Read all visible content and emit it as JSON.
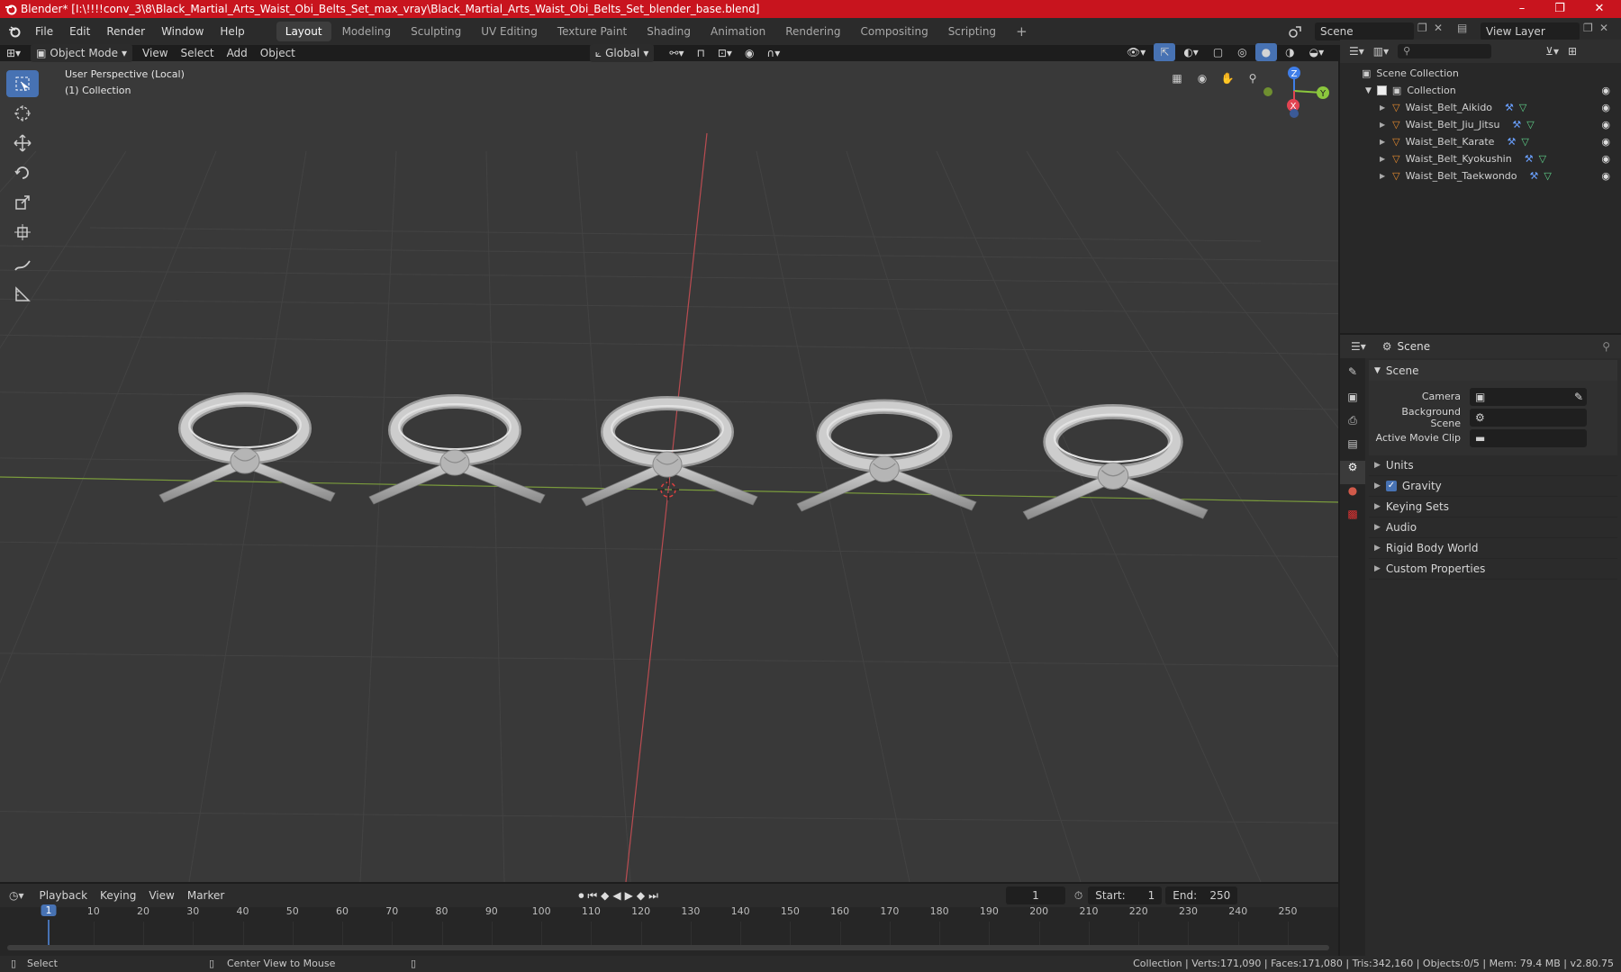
{
  "window": {
    "title": "Blender* [I:\\!!!!conv_3\\8\\Black_Martial_Arts_Waist_Obi_Belts_Set_max_vray\\Black_Martial_Arts_Waist_Obi_Belts_Set_blender_base.blend]",
    "controls": [
      "–",
      "❐",
      "✕"
    ]
  },
  "menubar": {
    "menus": [
      "File",
      "Edit",
      "Render",
      "Window",
      "Help"
    ],
    "workspaces": [
      "Layout",
      "Modeling",
      "Sculpting",
      "UV Editing",
      "Texture Paint",
      "Shading",
      "Animation",
      "Rendering",
      "Compositing",
      "Scripting"
    ],
    "active_workspace": "Layout",
    "add_tab": "+",
    "scene_name": "Scene",
    "view_layer": "View Layer"
  },
  "viewport_header": {
    "mode": "Object Mode",
    "menus": [
      "View",
      "Select",
      "Add",
      "Object"
    ],
    "transform_orientation": "Global"
  },
  "viewport": {
    "perspective_label": "User Perspective (Local)",
    "collection_label": "(1) Collection",
    "gizmo_axes": {
      "z": "Z",
      "y": "Y",
      "x": "X"
    }
  },
  "outliner": {
    "root": "Scene Collection",
    "collection": "Collection",
    "objects": [
      "Waist_Belt_Aikido",
      "Waist_Belt_Jiu_Jitsu",
      "Waist_Belt_Karate",
      "Waist_Belt_Kyokushin",
      "Waist_Belt_Taekwondo"
    ]
  },
  "properties": {
    "header": "Scene",
    "panel": "Scene",
    "fields": [
      {
        "label": "Camera"
      },
      {
        "label": "Background Scene"
      },
      {
        "label": "Active Movie Clip"
      }
    ],
    "sections": [
      "Units",
      "Gravity",
      "Keying Sets",
      "Audio",
      "Rigid Body World",
      "Custom Properties"
    ],
    "gravity_checked": true
  },
  "timeline": {
    "menus": [
      "Playback",
      "Keying",
      "View",
      "Marker"
    ],
    "current_frame": "1",
    "start_label": "Start:",
    "start": "1",
    "end_label": "End:",
    "end": "250",
    "ticks": [
      "1",
      "10",
      "20",
      "30",
      "40",
      "50",
      "60",
      "70",
      "80",
      "90",
      "100",
      "110",
      "120",
      "130",
      "140",
      "150",
      "160",
      "170",
      "180",
      "190",
      "200",
      "210",
      "220",
      "230",
      "240",
      "250"
    ]
  },
  "statusbar": {
    "left": "Select",
    "middle": "Center View to Mouse",
    "right": "Collection | Verts:171,090 | Faces:171,080 | Tris:342,160 | Objects:0/5 | Mem: 79.4 MB | v2.80.75"
  },
  "colors": {
    "title_red": "#c8141e",
    "accent_blue": "#4772b3",
    "object_orange": "#e48a2e",
    "axis_x": "#e24452",
    "axis_y": "#8bc73d",
    "axis_z": "#3f7ee8"
  }
}
